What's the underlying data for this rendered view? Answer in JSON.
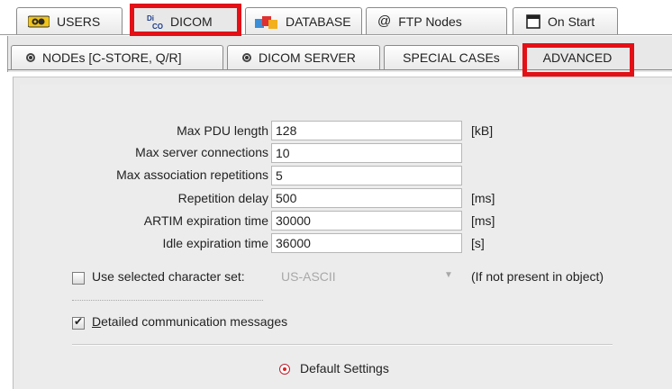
{
  "top_tabs": [
    {
      "label": "USERS",
      "icon": "users-icon"
    },
    {
      "label": "DICOM",
      "icon": "dicom-icon",
      "selected": true
    },
    {
      "label": "DATABASE",
      "icon": "database-icon"
    },
    {
      "label": "FTP Nodes",
      "icon": "at-icon",
      "icon_glyph": "@"
    },
    {
      "label": "On Start",
      "icon": "start-window-icon"
    }
  ],
  "sub_tabs": [
    {
      "label": "NODEs [C-STORE, Q/R]",
      "icon": "radio-dot-icon"
    },
    {
      "label": "DICOM SERVER",
      "icon": "radio-dot-icon"
    },
    {
      "label": "SPECIAL CASEs"
    },
    {
      "label": "ADVANCED",
      "selected": true
    }
  ],
  "settings": [
    {
      "label": "Max PDU length",
      "value": "128",
      "unit": "[kB]"
    },
    {
      "label": "Max server connections",
      "value": "10",
      "unit": ""
    },
    {
      "label": "Max association repetitions",
      "value": "5",
      "unit": ""
    },
    {
      "label": "Repetition delay",
      "value": "500",
      "unit": "[ms]"
    },
    {
      "label": "ARTIM expiration time",
      "value": "30000",
      "unit": "[ms]"
    },
    {
      "label": "Idle expiration time",
      "value": "36000",
      "unit": "[s]"
    }
  ],
  "charset": {
    "label": "Use selected character set:",
    "checked": false,
    "value": "US-ASCII",
    "note": "(If not present in object)"
  },
  "detailed_messages": {
    "label_accel": "D",
    "label_rest": "etailed communication messages",
    "checked": true
  },
  "default_settings": {
    "label": "Default Settings"
  },
  "colors": {
    "highlight": "#e31016",
    "panel": "#eaeaea",
    "radio_accent": "#d22222"
  }
}
